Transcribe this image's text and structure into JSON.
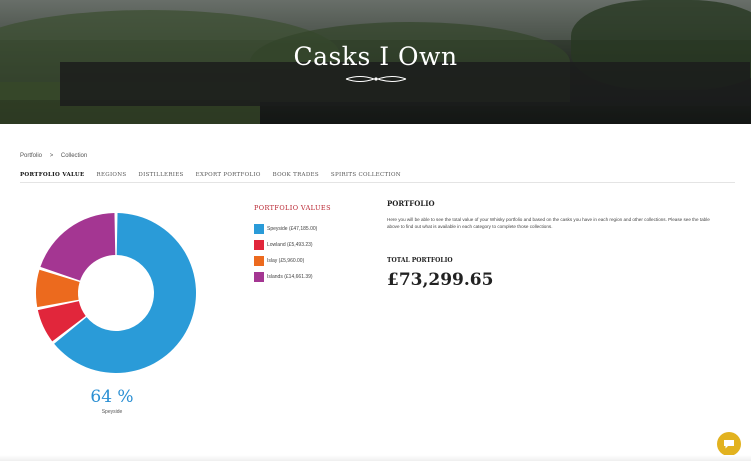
{
  "hero": {
    "title": "Casks I Own"
  },
  "breadcrumb": {
    "items": [
      "Portfolio",
      ">",
      "Collection"
    ]
  },
  "tabs": [
    {
      "label": "PORTFOLIO VALUE"
    },
    {
      "label": "REGIONS"
    },
    {
      "label": "DISTILLERIES"
    },
    {
      "label": "EXPORT PORTFOLIO"
    },
    {
      "label": "BOOK TRADES"
    },
    {
      "label": "SPIRITS COLLECTION"
    }
  ],
  "legend": {
    "title": "PORTFOLIO VALUES",
    "items": [
      {
        "label": "Speyside (£47,185.00)",
        "color": "#2a9bd8"
      },
      {
        "label": "Lowland (£5,493.23)",
        "color": "#e1263b"
      },
      {
        "label": "Islay (£5,960.00)",
        "color": "#ec6a1e"
      },
      {
        "label": "Islands (£14,661.39)",
        "color": "#a43692"
      }
    ]
  },
  "portfolio": {
    "heading": "PORTFOLIO",
    "description": "Here you will be able to see the total value of your Whisky portfolio and based on the casks you have in each region and other collections. Please see the table above to find out what is available in each category to complete those collections.",
    "total_label": "TOTAL PORTFOLIO",
    "total_value": "£73,299.65"
  },
  "chart_data": {
    "type": "pie",
    "categories": [
      "Speyside",
      "Lowland",
      "Islay",
      "Islands"
    ],
    "values": [
      47185.0,
      5493.23,
      5960.0,
      14661.39
    ],
    "colors": [
      "#2a9bd8",
      "#e1263b",
      "#ec6a1e",
      "#a43692"
    ],
    "center_percent": "64 %",
    "center_label": "Speyside"
  },
  "chat": {
    "icon": "chat-icon"
  }
}
